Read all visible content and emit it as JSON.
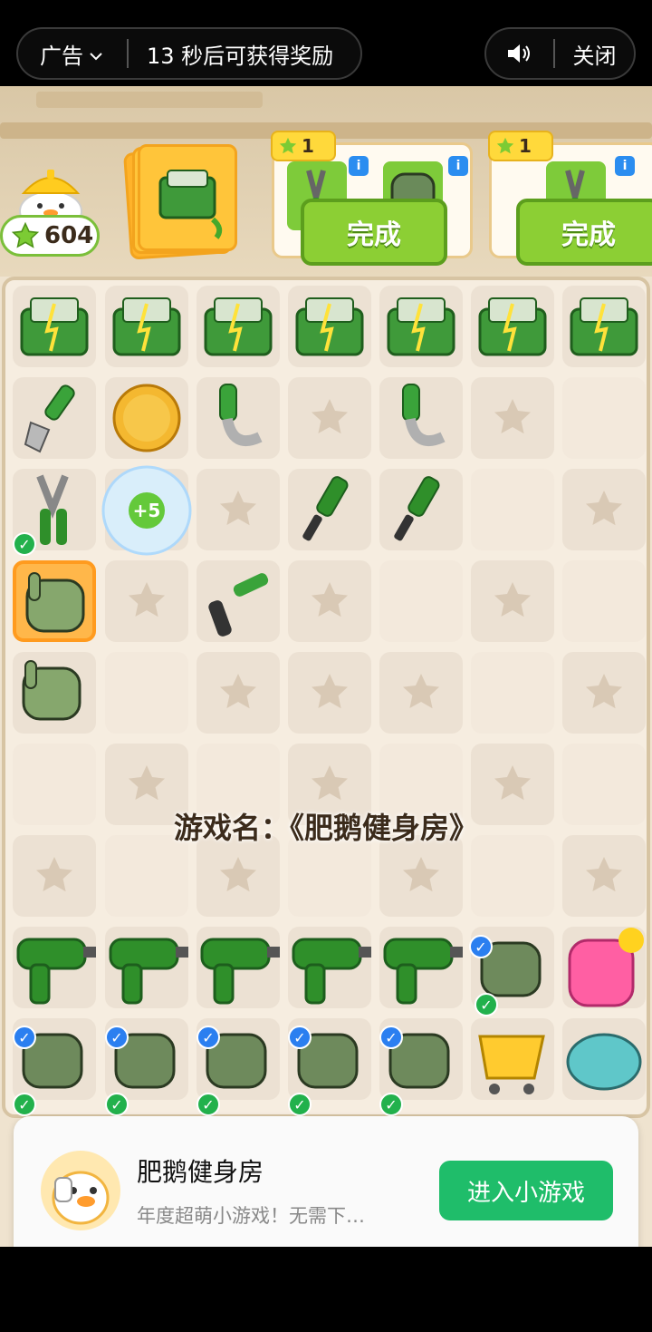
{
  "ad_bar": {
    "ad_label": "广告",
    "countdown_text": "13 秒后可获得奖励",
    "close_label": "关闭"
  },
  "hud": {
    "star_count": "604"
  },
  "orders": [
    {
      "reward": "1",
      "done_label": "完成"
    },
    {
      "reward": "1",
      "done_label": "完成"
    }
  ],
  "watermark": "游戏名：《肥鹅健身房》",
  "banner": {
    "title": "肥鹅健身房",
    "description": "年度超萌小游戏！无需下…",
    "cta": "进入小游戏"
  },
  "item_badges": {
    "plus": "+5"
  },
  "colors": {
    "accent_green": "#8ccf34",
    "cta_green": "#1fbd6a",
    "board_bg": "#f6ede0"
  }
}
